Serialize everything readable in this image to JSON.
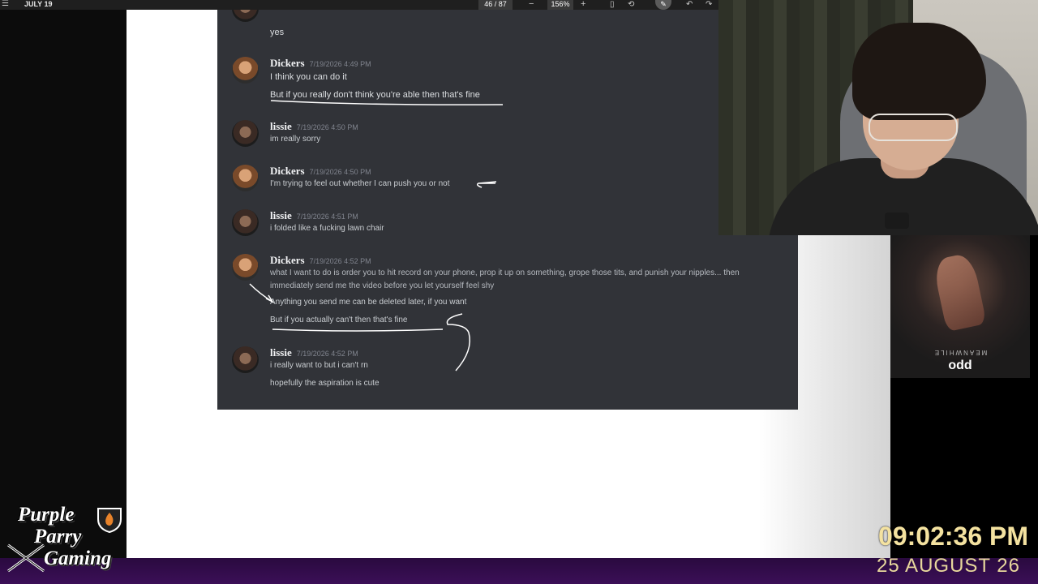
{
  "viewer": {
    "title": "JULY 19",
    "page_indicator": "46 / 87",
    "zoom": "156%",
    "icons": [
      "hamburger-menu-icon",
      "zoom-out-icon",
      "zoom-in-icon",
      "fit-page-icon",
      "rotate-icon",
      "draw-icon",
      "undo-icon",
      "redo-icon"
    ]
  },
  "chat": {
    "messages": [
      {
        "user": "",
        "time": "",
        "lines": [
          "yes"
        ]
      },
      {
        "user": "Dickers",
        "time": "7/19/2026 4:49 PM",
        "lines": [
          "I think you can do it",
          "But if you really don't think you're able then that's fine"
        ]
      },
      {
        "user": "lissie",
        "time": "7/19/2026 4:50 PM",
        "lines": [
          "im really sorry"
        ]
      },
      {
        "user": "Dickers",
        "time": "7/19/2026 4:50 PM",
        "lines": [
          "I'm trying to feel out whether I can push you or not"
        ]
      },
      {
        "user": "lissie",
        "time": "7/19/2026 4:51 PM",
        "lines": [
          "i folded like a fucking lawn chair"
        ]
      },
      {
        "user": "Dickers",
        "time": "7/19/2026 4:52 PM",
        "lines": [
          "what I want to do is order you to hit record on your phone, prop it up on something, grope those tits, and punish your nipples... then immediately send me the video before you let yourself feel shy",
          "Anything you send me can be deleted later, if you want",
          "But if you actually can't then that's fine"
        ]
      },
      {
        "user": "lissie",
        "time": "7/19/2026 4:52 PM",
        "lines": [
          "i really want to but i can't rn",
          "hopefully the aspiration is cute"
        ]
      }
    ]
  },
  "now_playing": {
    "album": "MEANWHILE",
    "artist": "odd"
  },
  "clock": {
    "time": "09:02:36 PM",
    "date": "25 AUGUST 26"
  },
  "logo": {
    "line1": "Purple",
    "line2": "Parry",
    "line3": "Gaming"
  },
  "colors": {
    "chat_bg": "#313338",
    "clock": "#f4e2a0",
    "bottom_bar": "#3b0f57"
  }
}
